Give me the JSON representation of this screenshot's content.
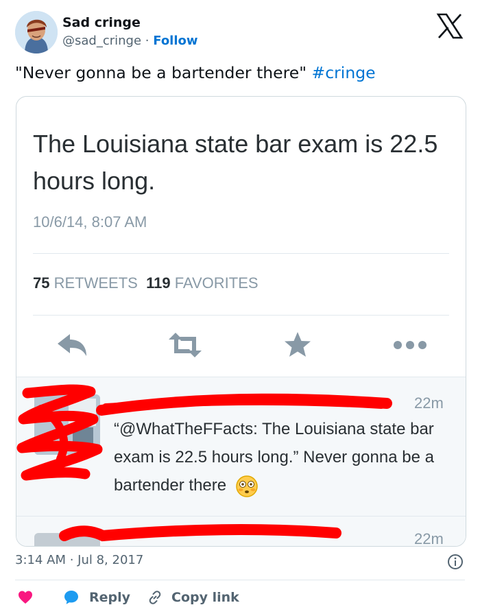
{
  "author": {
    "name": "Sad cringe",
    "handle": "@sad_cringe",
    "separator": "·",
    "follow_label": "Follow"
  },
  "tweet": {
    "text": "\"Never gonna be a bartender there\"",
    "hashtag": "#cringe"
  },
  "embedded_screenshot": {
    "text": "The Louisiana state bar exam is 22.5 hours long.",
    "date": "10/6/14, 8:07 AM",
    "retweets_count": "75",
    "retweets_label": "RETWEETS",
    "favorites_count": "119",
    "favorites_label": "FAVORITES",
    "actions": [
      "reply-icon",
      "retweet-icon",
      "star-icon",
      "more-icon"
    ],
    "reply": {
      "time": "22m",
      "text": "“@WhatTheFFacts: The Louisiana state bar exam is 22.5 hours long.” Never gonna be a bartender there",
      "emoji": "flushed-face-emoji"
    },
    "reply2": {
      "time": "22m"
    },
    "redaction_color": "#ff0000"
  },
  "footer": {
    "timestamp": "3:14 AM · Jul 8, 2017",
    "reply_label": "Reply",
    "copy_label": "Copy link"
  },
  "colors": {
    "link": "#0074d3",
    "heart": "#f91880",
    "muted": "#536471"
  }
}
